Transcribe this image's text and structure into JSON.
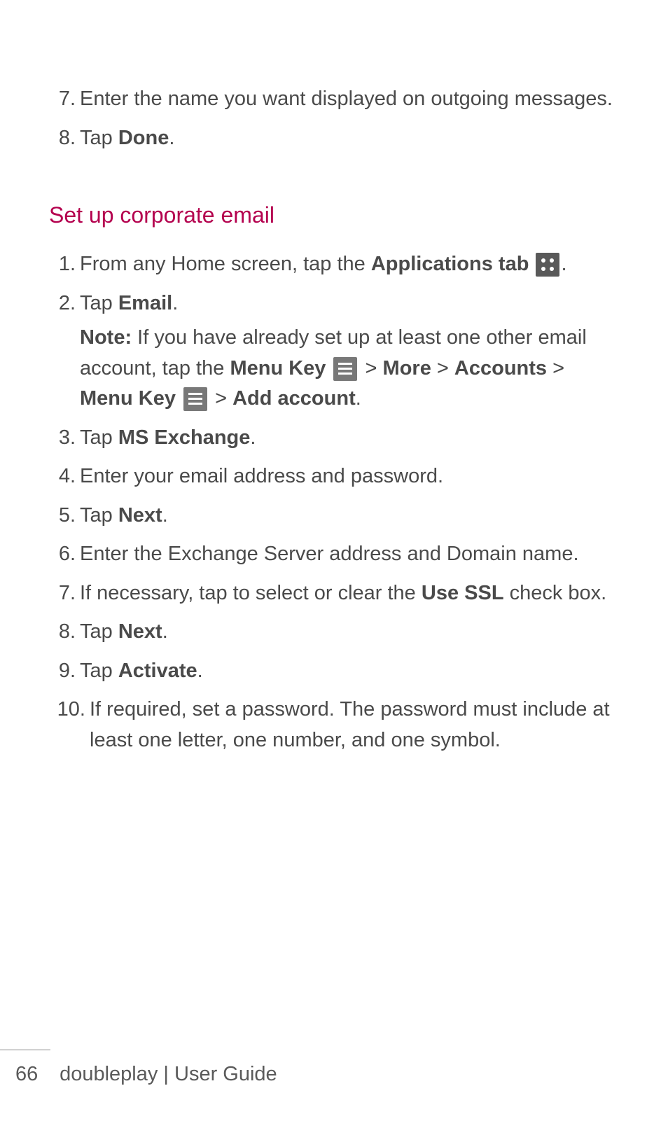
{
  "prev_steps": [
    {
      "num": "7.",
      "segments": [
        {
          "t": "Enter the name you want displayed on outgoing messages."
        }
      ]
    },
    {
      "num": "8.",
      "segments": [
        {
          "t": "Tap "
        },
        {
          "t": "Done",
          "b": true
        },
        {
          "t": "."
        }
      ]
    }
  ],
  "heading": "Set up corporate email",
  "steps": [
    {
      "num": "1.",
      "segments": [
        {
          "t": " From any Home screen, tap the "
        },
        {
          "t": "Applications tab",
          "b": true
        },
        {
          "t": " "
        },
        {
          "icon": "apps"
        },
        {
          "t": "."
        }
      ]
    },
    {
      "num": "2.",
      "segments": [
        {
          "t": "Tap "
        },
        {
          "t": "Email",
          "b": true
        },
        {
          "t": "."
        }
      ],
      "note": [
        {
          "t": "Note:",
          "b": true
        },
        {
          "t": " If you have already set up at least one other email account, tap the "
        },
        {
          "t": "Menu Key",
          "b": true
        },
        {
          "t": " "
        },
        {
          "icon": "menu"
        },
        {
          "t": " > "
        },
        {
          "t": "More",
          "b": true
        },
        {
          "t": " > "
        },
        {
          "t": "Accounts",
          "b": true
        },
        {
          "t": " > "
        },
        {
          "t": "Menu Key",
          "b": true
        },
        {
          "t": " "
        },
        {
          "icon": "menu"
        },
        {
          "t": " > "
        },
        {
          "t": "Add account",
          "b": true
        },
        {
          "t": "."
        }
      ]
    },
    {
      "num": "3.",
      "segments": [
        {
          "t": "Tap "
        },
        {
          "t": "MS Exchange",
          "b": true
        },
        {
          "t": "."
        }
      ]
    },
    {
      "num": "4.",
      "segments": [
        {
          "t": "Enter your email address and password."
        }
      ]
    },
    {
      "num": "5.",
      "segments": [
        {
          "t": "Tap "
        },
        {
          "t": "Next",
          "b": true
        },
        {
          "t": "."
        }
      ]
    },
    {
      "num": "6.",
      "segments": [
        {
          "t": "Enter the Exchange Server address and Domain name."
        }
      ]
    },
    {
      "num": "7.",
      "segments": [
        {
          "t": "If necessary, tap to select or clear the "
        },
        {
          "t": "Use SSL",
          "b": true
        },
        {
          "t": " check box."
        }
      ]
    },
    {
      "num": "8.",
      "segments": [
        {
          "t": "Tap "
        },
        {
          "t": "Next",
          "b": true
        },
        {
          "t": "."
        }
      ]
    },
    {
      "num": "9.",
      "segments": [
        {
          "t": "Tap "
        },
        {
          "t": "Activate",
          "b": true
        },
        {
          "t": "."
        }
      ]
    },
    {
      "num": "10.",
      "wide": true,
      "segments": [
        {
          "t": " If required, set a password. The password must include at least one letter, one number, and one symbol."
        }
      ]
    }
  ],
  "footer": {
    "page": "66",
    "title": "doubleplay  |  User Guide"
  }
}
